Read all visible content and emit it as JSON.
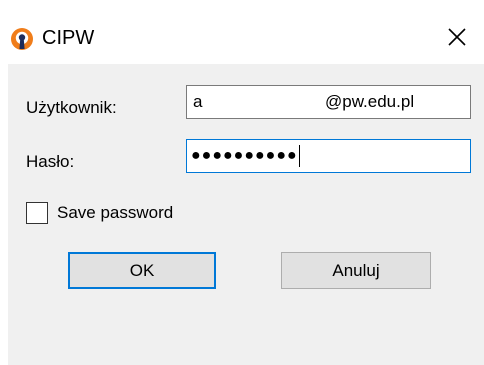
{
  "window": {
    "title": "CIPW",
    "app_icon": "openvpn-icon",
    "close_icon": "close-icon"
  },
  "form": {
    "username_label": "Użytkownik:",
    "username_prefix": "a",
    "username_domain": "@pw.edu.pl",
    "password_label": "Hasło:",
    "password_mask": "●●●●●●●●●●",
    "save_password": {
      "label": "Save password",
      "checked": false
    }
  },
  "buttons": {
    "ok_label": "OK",
    "cancel_label": "Anuluj"
  },
  "colors": {
    "accent": "#0078d7",
    "icon_orange": "#f07d1a",
    "client_bg": "#f0f0f0",
    "button_bg": "#e1e1e1"
  }
}
